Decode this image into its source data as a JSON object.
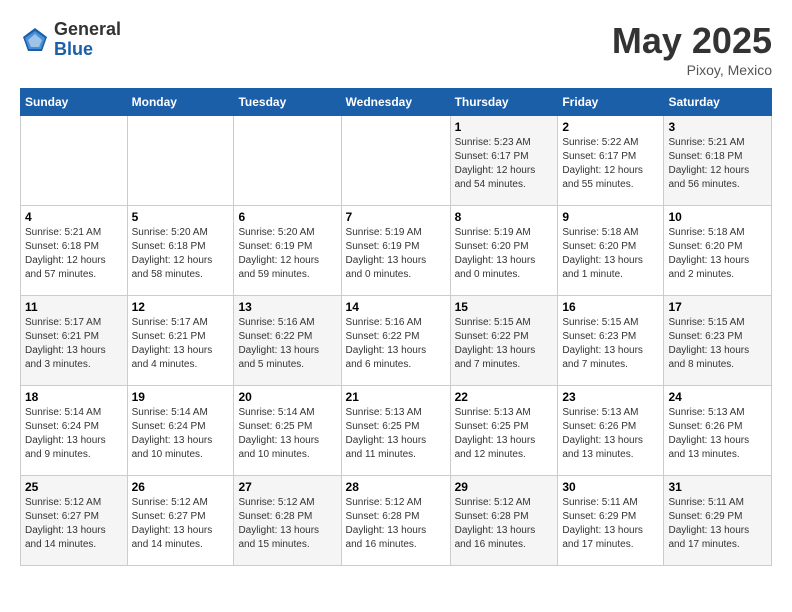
{
  "header": {
    "logo_general": "General",
    "logo_blue": "Blue",
    "month_year": "May 2025",
    "location": "Pixoy, Mexico"
  },
  "weekdays": [
    "Sunday",
    "Monday",
    "Tuesday",
    "Wednesday",
    "Thursday",
    "Friday",
    "Saturday"
  ],
  "weeks": [
    [
      {
        "day": "",
        "info": ""
      },
      {
        "day": "",
        "info": ""
      },
      {
        "day": "",
        "info": ""
      },
      {
        "day": "",
        "info": ""
      },
      {
        "day": "1",
        "info": "Sunrise: 5:23 AM\nSunset: 6:17 PM\nDaylight: 12 hours\nand 54 minutes."
      },
      {
        "day": "2",
        "info": "Sunrise: 5:22 AM\nSunset: 6:17 PM\nDaylight: 12 hours\nand 55 minutes."
      },
      {
        "day": "3",
        "info": "Sunrise: 5:21 AM\nSunset: 6:18 PM\nDaylight: 12 hours\nand 56 minutes."
      }
    ],
    [
      {
        "day": "4",
        "info": "Sunrise: 5:21 AM\nSunset: 6:18 PM\nDaylight: 12 hours\nand 57 minutes."
      },
      {
        "day": "5",
        "info": "Sunrise: 5:20 AM\nSunset: 6:18 PM\nDaylight: 12 hours\nand 58 minutes."
      },
      {
        "day": "6",
        "info": "Sunrise: 5:20 AM\nSunset: 6:19 PM\nDaylight: 12 hours\nand 59 minutes."
      },
      {
        "day": "7",
        "info": "Sunrise: 5:19 AM\nSunset: 6:19 PM\nDaylight: 13 hours\nand 0 minutes."
      },
      {
        "day": "8",
        "info": "Sunrise: 5:19 AM\nSunset: 6:20 PM\nDaylight: 13 hours\nand 0 minutes."
      },
      {
        "day": "9",
        "info": "Sunrise: 5:18 AM\nSunset: 6:20 PM\nDaylight: 13 hours\nand 1 minute."
      },
      {
        "day": "10",
        "info": "Sunrise: 5:18 AM\nSunset: 6:20 PM\nDaylight: 13 hours\nand 2 minutes."
      }
    ],
    [
      {
        "day": "11",
        "info": "Sunrise: 5:17 AM\nSunset: 6:21 PM\nDaylight: 13 hours\nand 3 minutes."
      },
      {
        "day": "12",
        "info": "Sunrise: 5:17 AM\nSunset: 6:21 PM\nDaylight: 13 hours\nand 4 minutes."
      },
      {
        "day": "13",
        "info": "Sunrise: 5:16 AM\nSunset: 6:22 PM\nDaylight: 13 hours\nand 5 minutes."
      },
      {
        "day": "14",
        "info": "Sunrise: 5:16 AM\nSunset: 6:22 PM\nDaylight: 13 hours\nand 6 minutes."
      },
      {
        "day": "15",
        "info": "Sunrise: 5:15 AM\nSunset: 6:22 PM\nDaylight: 13 hours\nand 7 minutes."
      },
      {
        "day": "16",
        "info": "Sunrise: 5:15 AM\nSunset: 6:23 PM\nDaylight: 13 hours\nand 7 minutes."
      },
      {
        "day": "17",
        "info": "Sunrise: 5:15 AM\nSunset: 6:23 PM\nDaylight: 13 hours\nand 8 minutes."
      }
    ],
    [
      {
        "day": "18",
        "info": "Sunrise: 5:14 AM\nSunset: 6:24 PM\nDaylight: 13 hours\nand 9 minutes."
      },
      {
        "day": "19",
        "info": "Sunrise: 5:14 AM\nSunset: 6:24 PM\nDaylight: 13 hours\nand 10 minutes."
      },
      {
        "day": "20",
        "info": "Sunrise: 5:14 AM\nSunset: 6:25 PM\nDaylight: 13 hours\nand 10 minutes."
      },
      {
        "day": "21",
        "info": "Sunrise: 5:13 AM\nSunset: 6:25 PM\nDaylight: 13 hours\nand 11 minutes."
      },
      {
        "day": "22",
        "info": "Sunrise: 5:13 AM\nSunset: 6:25 PM\nDaylight: 13 hours\nand 12 minutes."
      },
      {
        "day": "23",
        "info": "Sunrise: 5:13 AM\nSunset: 6:26 PM\nDaylight: 13 hours\nand 13 minutes."
      },
      {
        "day": "24",
        "info": "Sunrise: 5:13 AM\nSunset: 6:26 PM\nDaylight: 13 hours\nand 13 minutes."
      }
    ],
    [
      {
        "day": "25",
        "info": "Sunrise: 5:12 AM\nSunset: 6:27 PM\nDaylight: 13 hours\nand 14 minutes."
      },
      {
        "day": "26",
        "info": "Sunrise: 5:12 AM\nSunset: 6:27 PM\nDaylight: 13 hours\nand 14 minutes."
      },
      {
        "day": "27",
        "info": "Sunrise: 5:12 AM\nSunset: 6:28 PM\nDaylight: 13 hours\nand 15 minutes."
      },
      {
        "day": "28",
        "info": "Sunrise: 5:12 AM\nSunset: 6:28 PM\nDaylight: 13 hours\nand 16 minutes."
      },
      {
        "day": "29",
        "info": "Sunrise: 5:12 AM\nSunset: 6:28 PM\nDaylight: 13 hours\nand 16 minutes."
      },
      {
        "day": "30",
        "info": "Sunrise: 5:11 AM\nSunset: 6:29 PM\nDaylight: 13 hours\nand 17 minutes."
      },
      {
        "day": "31",
        "info": "Sunrise: 5:11 AM\nSunset: 6:29 PM\nDaylight: 13 hours\nand 17 minutes."
      }
    ]
  ]
}
